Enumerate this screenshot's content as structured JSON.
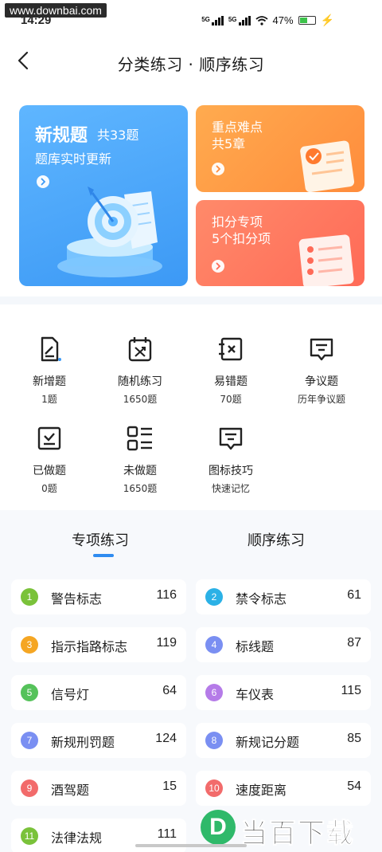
{
  "watermark_top": "www.downbai.com",
  "status": {
    "time": "14:29",
    "sig1_label": "5G",
    "sig2_label": "5G",
    "battery": "47%"
  },
  "nav": {
    "title": "分类练习 · 顺序练习"
  },
  "cards": {
    "big": {
      "title": "新规题",
      "count": "共33题",
      "subtitle": "题库实时更新"
    },
    "orange": {
      "line1": "重点难点",
      "line2": "共5章"
    },
    "red": {
      "line1": "扣分专项",
      "line2": "5个扣分项"
    }
  },
  "grid": [
    {
      "label": "新增题",
      "sub": "1题",
      "icon": "new-doc-icon"
    },
    {
      "label": "随机练习",
      "sub": "1650题",
      "icon": "shuffle-calendar-icon"
    },
    {
      "label": "易错题",
      "sub": "70题",
      "icon": "error-book-icon"
    },
    {
      "label": "争议题",
      "sub": "历年争议题",
      "icon": "dispute-chat-icon"
    },
    {
      "label": "已做题",
      "sub": "0题",
      "icon": "done-check-icon"
    },
    {
      "label": "未做题",
      "sub": "1650题",
      "icon": "todo-list-icon"
    },
    {
      "label": "图标技巧",
      "sub": "快速记忆",
      "icon": "tips-chat-icon"
    }
  ],
  "tabs": [
    {
      "label": "专项练习",
      "active": true
    },
    {
      "label": "顺序练习",
      "active": false
    }
  ],
  "categories": [
    {
      "num": "1",
      "name": "警告标志",
      "count": "116",
      "color": "#7ac23a"
    },
    {
      "num": "2",
      "name": "禁令标志",
      "count": "61",
      "color": "#2bb1e6"
    },
    {
      "num": "3",
      "name": "指示指路标志",
      "count": "119",
      "color": "#f5a623"
    },
    {
      "num": "4",
      "name": "标线题",
      "count": "87",
      "color": "#7a8ff2"
    },
    {
      "num": "5",
      "name": "信号灯",
      "count": "64",
      "color": "#55c25a"
    },
    {
      "num": "6",
      "name": "车仪表",
      "count": "115",
      "color": "#b57be8"
    },
    {
      "num": "7",
      "name": "新规刑罚题",
      "count": "124",
      "color": "#7a8ff2"
    },
    {
      "num": "8",
      "name": "新规记分题",
      "count": "85",
      "color": "#7a8ff2"
    },
    {
      "num": "9",
      "name": "酒驾题",
      "count": "15",
      "color": "#f26b6b"
    },
    {
      "num": "10",
      "name": "速度距离",
      "count": "54",
      "color": "#f26b6b"
    },
    {
      "num": "11",
      "name": "法律法规",
      "count": "111",
      "color": "#7ac23a"
    }
  ],
  "logo_watermark": {
    "letter": "D",
    "text": "当百下载"
  },
  "colors": {
    "primary": "#2f8cf0",
    "card_blue": "#4aa6f8",
    "card_orange": "#ff9a44",
    "card_red": "#ff755e"
  }
}
